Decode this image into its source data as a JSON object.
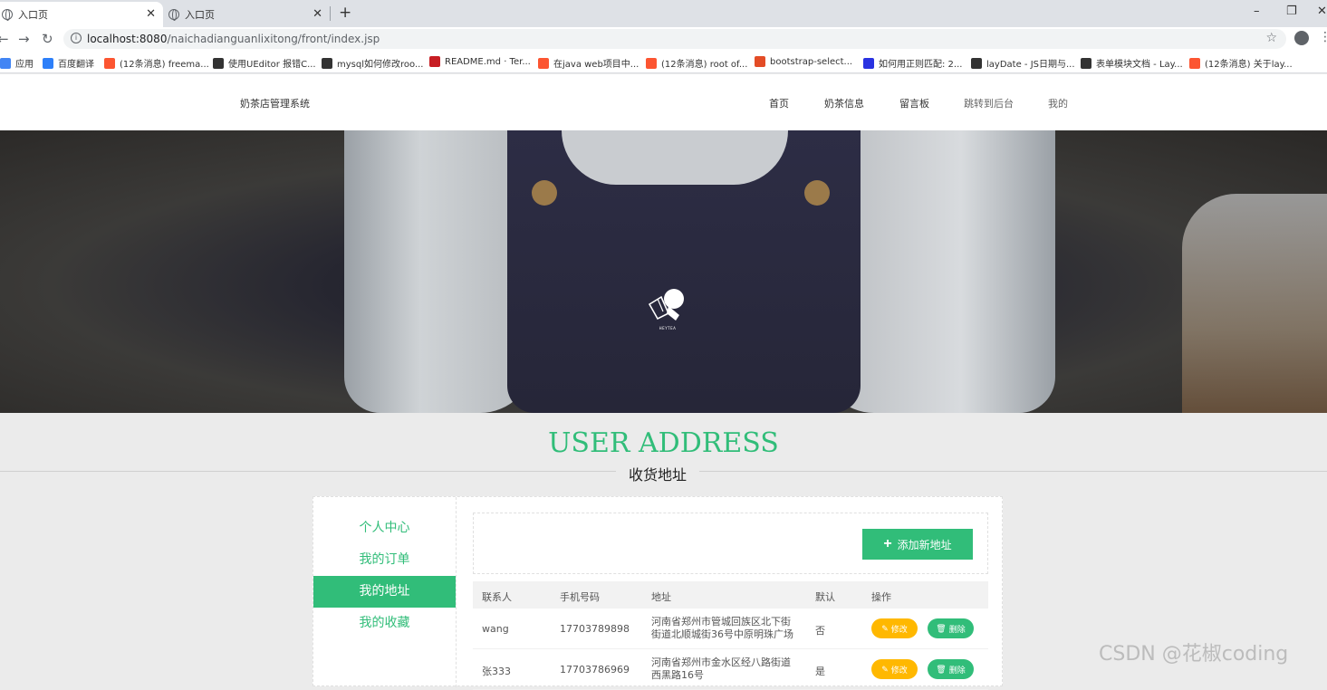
{
  "browser": {
    "tabs": [
      {
        "title": "入口页",
        "active": true
      },
      {
        "title": "入口页",
        "active": false
      }
    ],
    "new_tab": "+",
    "close": "✕",
    "url_host": "localhost:8080",
    "url_path": "/naichadianguanlixitong/front/index.jsp",
    "window_controls": {
      "minimize": "–",
      "restore": "❐",
      "close": "✕"
    },
    "bookmarks": [
      {
        "label": "应用",
        "icon": "apps-icon",
        "color": "#4285f4"
      },
      {
        "label": "百度翻译",
        "icon": "baidu-translate-icon",
        "color": "#2d7ff9"
      },
      {
        "label": "(12条消息) freema...",
        "icon": "csdn-icon",
        "color": "#fc5531"
      },
      {
        "label": "使用UEditor 报错C...",
        "icon": "yuque-icon",
        "color": "#333333"
      },
      {
        "label": "mysql如何修改roo...",
        "icon": "yuque-icon",
        "color": "#333333"
      },
      {
        "label": "README.md · Ter...",
        "icon": "gitee-icon",
        "color": "#c71d23"
      },
      {
        "label": "在java web项目中...",
        "icon": "csdn-icon",
        "color": "#fc5531"
      },
      {
        "label": "(12条消息) root of...",
        "icon": "csdn-icon",
        "color": "#fc5531"
      },
      {
        "label": "bootstrap-select...",
        "icon": "bookmark-icon",
        "color": "#e34c26"
      },
      {
        "label": "如何用正则匹配: 2...",
        "icon": "baidu-paw-icon",
        "color": "#2932e1"
      },
      {
        "label": "layDate - JS日期与...",
        "icon": "layui-icon",
        "color": "#333333"
      },
      {
        "label": "表单模块文档 - Lay...",
        "icon": "layui-icon",
        "color": "#333333"
      },
      {
        "label": "(12条消息) 关于lay...",
        "icon": "csdn-icon",
        "color": "#fc5531"
      }
    ]
  },
  "site": {
    "title": "奶茶店管理系统",
    "nav": [
      "首页",
      "奶茶信息",
      "留言板",
      "跳转到后台",
      "我的"
    ],
    "banner_logo_text": "HEYTEA"
  },
  "section": {
    "title": "USER ADDRESS",
    "subtitle": "收货地址"
  },
  "sidebar": {
    "items": [
      {
        "label": "个人中心",
        "active": false
      },
      {
        "label": "我的订单",
        "active": false
      },
      {
        "label": "我的地址",
        "active": true
      },
      {
        "label": "我的收藏",
        "active": false
      }
    ]
  },
  "toolbar": {
    "add_label": "添加新地址"
  },
  "table": {
    "headers": [
      "联系人",
      "手机号码",
      "地址",
      "默认",
      "操作"
    ],
    "rows": [
      {
        "contact": "wang",
        "phone": "17703789898",
        "address": "河南省郑州市管城回族区北下街街道北顺城街36号中原明珠广场",
        "default": "否"
      },
      {
        "contact": "张333",
        "phone": "17703786969",
        "address": "河南省郑州市金水区经八路街道西黑路16号",
        "default": "是"
      }
    ],
    "edit_label": "修改",
    "delete_label": "删除"
  },
  "watermark": "CSDN @花椒coding",
  "colors": {
    "accent": "#31bd79",
    "edit": "#ffb800",
    "page_bg": "#ebebeb"
  }
}
